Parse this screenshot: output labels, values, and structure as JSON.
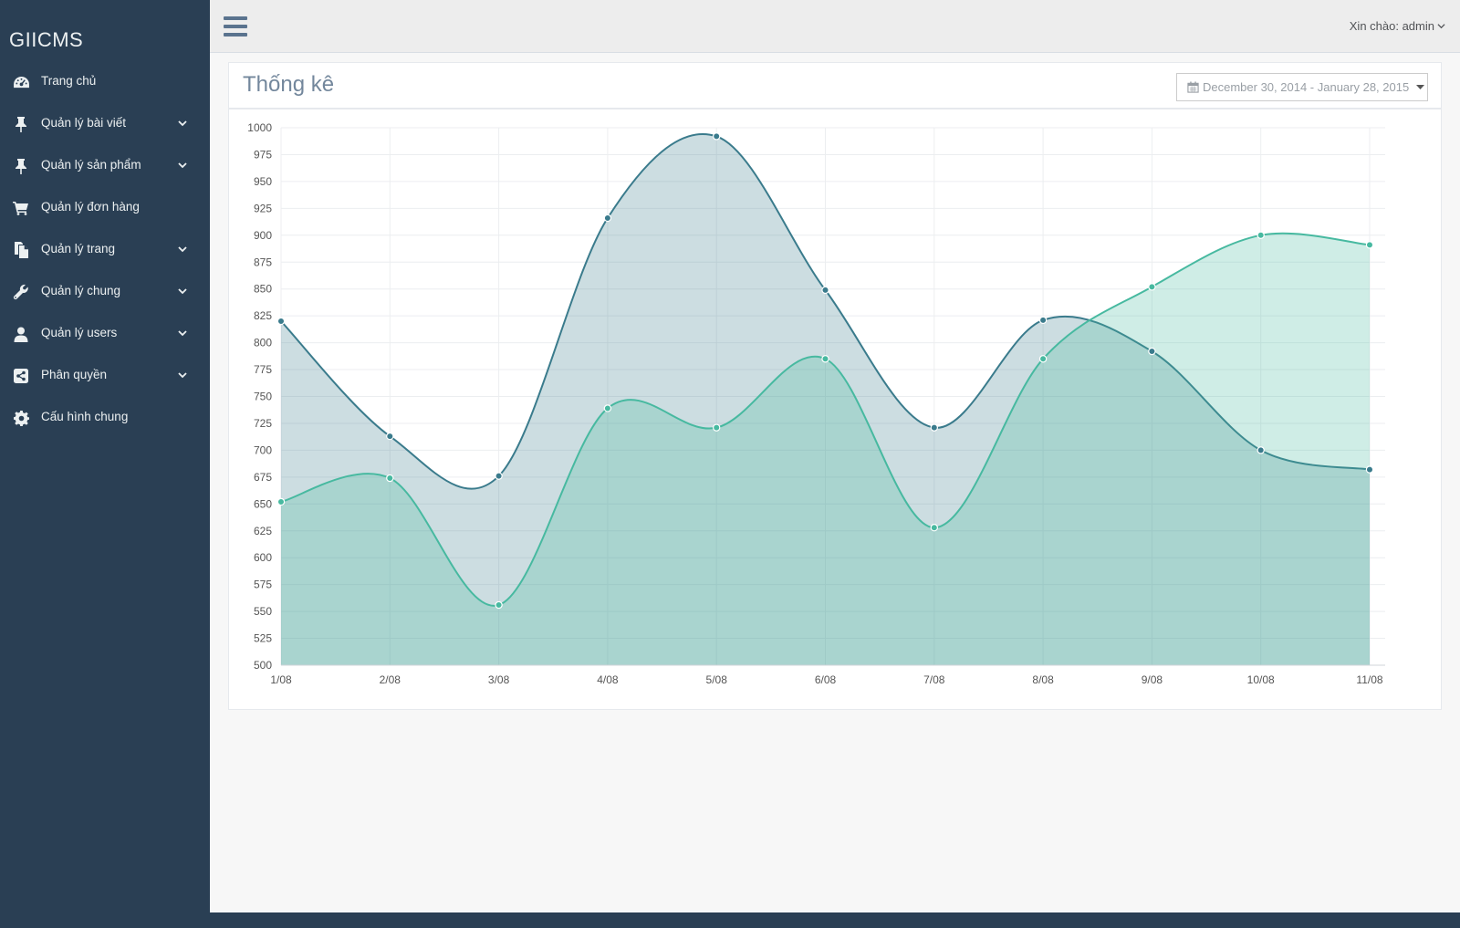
{
  "app": {
    "brand": "GIICMS"
  },
  "colors": {
    "sidebar_bg": "#2a3f54",
    "series_1": "#3a7b8c",
    "series_2": "#47b9a0"
  },
  "sidebar": {
    "items": [
      {
        "label": "Trang chủ",
        "icon": "dashboard-icon",
        "has_submenu": false
      },
      {
        "label": "Quản lý bài viết",
        "icon": "pin-icon",
        "has_submenu": true
      },
      {
        "label": "Quản lý sản phẩm",
        "icon": "pin-icon",
        "has_submenu": true
      },
      {
        "label": "Quản lý đơn hàng",
        "icon": "cart-icon",
        "has_submenu": false
      },
      {
        "label": "Quản lý trang",
        "icon": "files-icon",
        "has_submenu": true
      },
      {
        "label": "Quản lý chung",
        "icon": "wrench-icon",
        "has_submenu": true
      },
      {
        "label": "Quản lý users",
        "icon": "user-icon",
        "has_submenu": true
      },
      {
        "label": "Phân quyền",
        "icon": "share-icon",
        "has_submenu": true
      },
      {
        "label": "Cấu hình chung",
        "icon": "gear-icon",
        "has_submenu": false
      }
    ]
  },
  "topbar": {
    "greeting": "Xin chào: admin"
  },
  "panel": {
    "title": "Thống kê",
    "date_range": "December 30, 2014 - January 28, 2015"
  },
  "chart_data": {
    "type": "area",
    "x": [
      "1/08",
      "2/08",
      "3/08",
      "4/08",
      "5/08",
      "6/08",
      "7/08",
      "8/08",
      "9/08",
      "10/08",
      "11/08"
    ],
    "series": [
      {
        "values": [
          820,
          713,
          676,
          916,
          992,
          849,
          721,
          821,
          792,
          700,
          682
        ],
        "color": "#3a7b8c"
      },
      {
        "values": [
          652,
          674,
          556,
          739,
          721,
          785,
          628,
          785,
          852,
          900,
          891
        ],
        "color": "#47b9a0"
      }
    ],
    "ylim": [
      500,
      1000
    ],
    "yticks": [
      500,
      525,
      550,
      575,
      600,
      625,
      650,
      675,
      700,
      725,
      750,
      775,
      800,
      825,
      850,
      875,
      900,
      925,
      950,
      975,
      1000
    ],
    "grid": true,
    "xlabel": "",
    "ylabel": ""
  }
}
